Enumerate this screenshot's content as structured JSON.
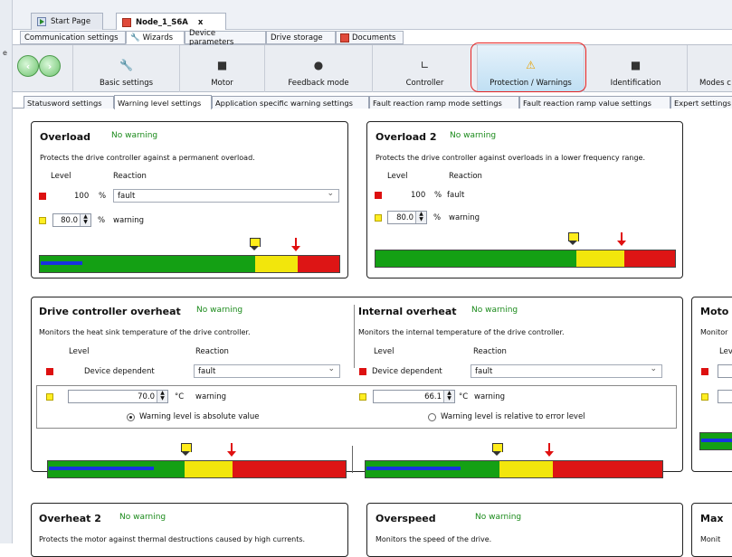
{
  "window": {
    "side_label": "e"
  },
  "doc_tabs": [
    {
      "label": "Start Page"
    },
    {
      "label": "Node_1_S6A",
      "close": "x"
    }
  ],
  "sub_tabs": [
    "Communication settings",
    "Wizards",
    "Device parameters",
    "Drive storage",
    "Documents"
  ],
  "toolbar": {
    "items": [
      "Basic settings",
      "Motor",
      "Feedback mode",
      "Controller",
      "Protection / Warnings",
      "Identification",
      "Modes c"
    ]
  },
  "setting_tabs": [
    "Statusword settings",
    "Warning level settings",
    "Application specific warning settings",
    "Fault reaction ramp mode settings",
    "Fault reaction ramp value settings",
    "Expert settings"
  ],
  "colors": {
    "accent": "#e52020",
    "green": "#14a014",
    "yellow": "#f2e60c",
    "red": "#dd1515",
    "status": "#1a8a1a"
  },
  "panels": {
    "overload": {
      "title": "Overload",
      "status": "No warning",
      "desc": "Protects the drive controller against a permanent overload.",
      "level_hdr": "Level",
      "reaction_hdr": "Reaction",
      "fault_level": "100",
      "fault_unit": "%",
      "fault_reaction": "fault",
      "warn_value": "80.0",
      "warn_unit": "%",
      "warn_reaction": "warning"
    },
    "overload2": {
      "title": "Overload 2",
      "status": "No warning",
      "desc": "Protects the drive controller against overloads in a lower frequency range.",
      "level_hdr": "Level",
      "reaction_hdr": "Reaction",
      "fault_level": "100",
      "fault_unit": "%",
      "fault_reaction": "fault",
      "warn_value": "80.0",
      "warn_unit": "%",
      "warn_reaction": "warning"
    },
    "drive_overheat": {
      "title": "Drive controller overheat",
      "status": "No warning",
      "desc": "Monitors the heat sink temperature of the drive controller.",
      "level_hdr": "Level",
      "reaction_hdr": "Reaction",
      "fault_level": "Device dependent",
      "fault_reaction": "fault",
      "warn_value": "70.0",
      "warn_unit": "°C",
      "warn_reaction": "warning"
    },
    "internal_overheat": {
      "title": "Internal overheat",
      "status": "No warning",
      "desc": "Monitors the internal temperature of the drive controller.",
      "level_hdr": "Level",
      "reaction_hdr": "Reaction",
      "fault_level": "Device dependent",
      "fault_reaction": "fault",
      "warn_value": "66.1",
      "warn_unit": "°C",
      "warn_reaction": "warning"
    },
    "radio_absolute": "Warning level is absolute value",
    "radio_relative": "Warning level is relative to error level",
    "motor_partial": {
      "title": "Moto",
      "desc": "Monitor",
      "level_hdr": "Lev"
    },
    "overheat2": {
      "title": "Overheat 2",
      "status": "No warning",
      "desc": "Protects the motor against thermal destructions caused by high currents."
    },
    "overspeed": {
      "title": "Overspeed",
      "status": "No warning",
      "desc": "Monitors the speed of the drive."
    },
    "max_partial": {
      "title": "Max",
      "desc": "Monit"
    }
  }
}
